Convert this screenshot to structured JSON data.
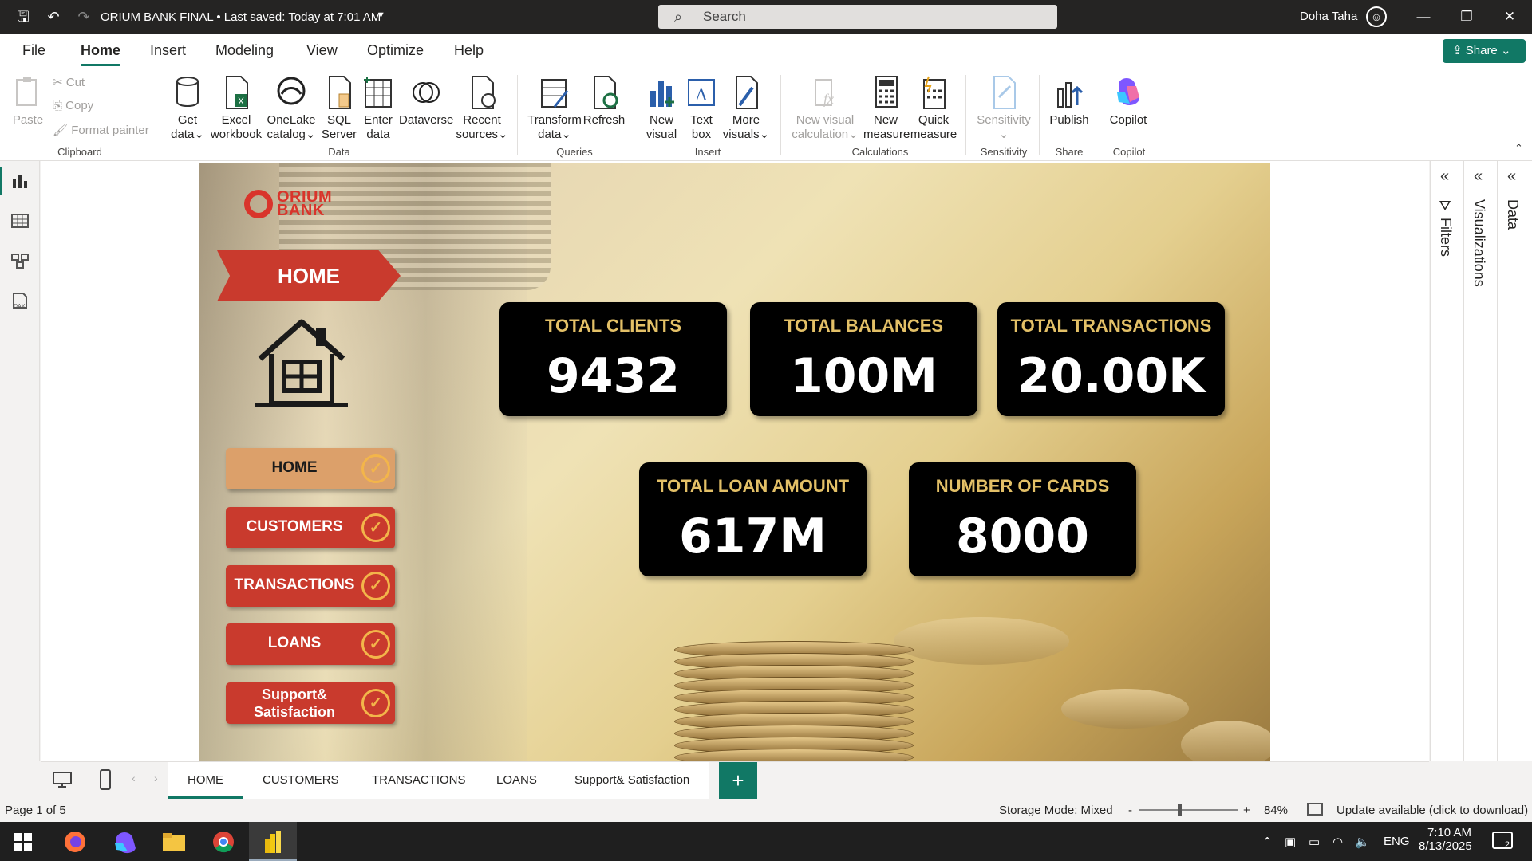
{
  "titlebar": {
    "file_title": "ORIUM BANK FINAL",
    "saved": "• Last saved: Today at 7:01 AM",
    "search_placeholder": "Search",
    "user": "Doha Taha"
  },
  "ribbon_tabs": [
    "File",
    "Home",
    "Insert",
    "Modeling",
    "View",
    "Optimize",
    "Help"
  ],
  "share_label": "Share",
  "clipboard": {
    "paste": "Paste",
    "cut": "Cut",
    "copy": "Copy",
    "format_painter": "Format painter",
    "group": "Clipboard"
  },
  "data_group": {
    "get_data": [
      "Get",
      "data"
    ],
    "excel": [
      "Excel",
      "workbook"
    ],
    "onelake": [
      "OneLake",
      "catalog"
    ],
    "sql": [
      "SQL",
      "Server"
    ],
    "enter": [
      "Enter",
      "data"
    ],
    "dataverse": "Dataverse",
    "recent": [
      "Recent",
      "sources"
    ],
    "group": "Data"
  },
  "queries": {
    "transform": [
      "Transform",
      "data"
    ],
    "refresh": "Refresh",
    "group": "Queries"
  },
  "insert": {
    "new_visual": [
      "New",
      "visual"
    ],
    "text_box": [
      "Text",
      "box"
    ],
    "more_visuals": [
      "More",
      "visuals"
    ],
    "group": "Insert"
  },
  "calculations": {
    "new_visual_calc": [
      "New visual",
      "calculation"
    ],
    "new_measure": [
      "New",
      "measure"
    ],
    "quick_measure": [
      "Quick",
      "measure"
    ],
    "group": "Calculations"
  },
  "sensitivity": {
    "label": "Sensitivity",
    "group": "Sensitivity"
  },
  "share_group": {
    "publish": "Publish",
    "group": "Share"
  },
  "copilot": {
    "label": "Copilot",
    "group": "Copilot"
  },
  "report": {
    "logo": [
      "ORIUM",
      "BANK"
    ],
    "banner": "HOME",
    "nav": [
      {
        "label": "HOME"
      },
      {
        "label": "CUSTOMERS"
      },
      {
        "label": "TRANSACTIONS"
      },
      {
        "label": "LOANS"
      },
      {
        "label": "Support&",
        "label2": "Satisfaction"
      }
    ],
    "cards": [
      {
        "title": "TOTAL CLIENTS",
        "value": "9432"
      },
      {
        "title": "TOTAL BALANCES",
        "value": "100M"
      },
      {
        "title": "TOTAL TRANSACTIONS",
        "value": "20.00K"
      },
      {
        "title": "TOTAL LOAN AMOUNT",
        "value": "617M"
      },
      {
        "title": "NUMBER OF CARDS",
        "value": "8000"
      }
    ]
  },
  "panes": {
    "filters": "Filters",
    "visualizations": "Visualizations",
    "data": "Data"
  },
  "page_tabs": [
    "HOME",
    "CUSTOMERS",
    "TRANSACTIONS",
    "LOANS",
    "Support& Satisfaction"
  ],
  "status": {
    "page": "Page 1 of 5",
    "storage": "Storage Mode: Mixed",
    "zoom": "84%",
    "update": "Update available (click to download)"
  },
  "clock": {
    "time": "7:10 AM",
    "date": "8/13/2025",
    "lang": "ENG",
    "notif": "2"
  }
}
